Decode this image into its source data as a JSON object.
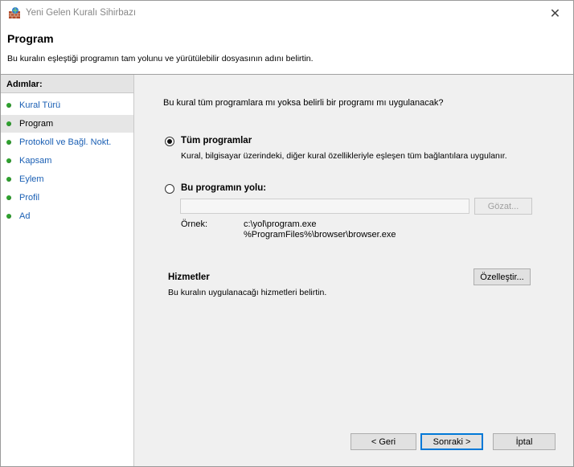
{
  "window": {
    "title": "Yeni Gelen Kuralı Sihirbazı",
    "close_symbol": "✕"
  },
  "header": {
    "title": "Program",
    "description": "Bu kuralın eşleştiği programın tam yolunu ve yürütülebilir dosyasının adını belirtin."
  },
  "sidebar": {
    "header": "Adımlar:",
    "items": [
      {
        "label": "Kural Türü",
        "current": false
      },
      {
        "label": "Program",
        "current": true
      },
      {
        "label": "Protokoll ve Bağl. Nokt.",
        "current": false
      },
      {
        "label": "Kapsam",
        "current": false
      },
      {
        "label": "Eylem",
        "current": false
      },
      {
        "label": "Profil",
        "current": false
      },
      {
        "label": "Ad",
        "current": false
      }
    ]
  },
  "main": {
    "question": "Bu kural tüm programlara mı yoksa belirli bir programı mı uygulanacak?",
    "all_programs": {
      "label": "Tüm programlar",
      "description": "Kural, bilgisayar üzerindeki, diğer kural özellikleriyle eşleşen tüm bağlantılara uygulanır.",
      "selected": true
    },
    "program_path": {
      "label": "Bu programın yolu:",
      "selected": false,
      "value": "",
      "browse_label": "Gözat...",
      "example_label": "Örnek:",
      "example_line1": "c:\\yol\\program.exe",
      "example_line2": "%ProgramFiles%\\browser\\browser.exe"
    },
    "services": {
      "title": "Hizmetler",
      "description": "Bu kuralın uygulanacağı hizmetleri belirtin.",
      "customize_label": "Özelleştir..."
    }
  },
  "footer": {
    "back_label": "< Geri",
    "next_label": "Sonraki >",
    "cancel_label": "İptal"
  }
}
